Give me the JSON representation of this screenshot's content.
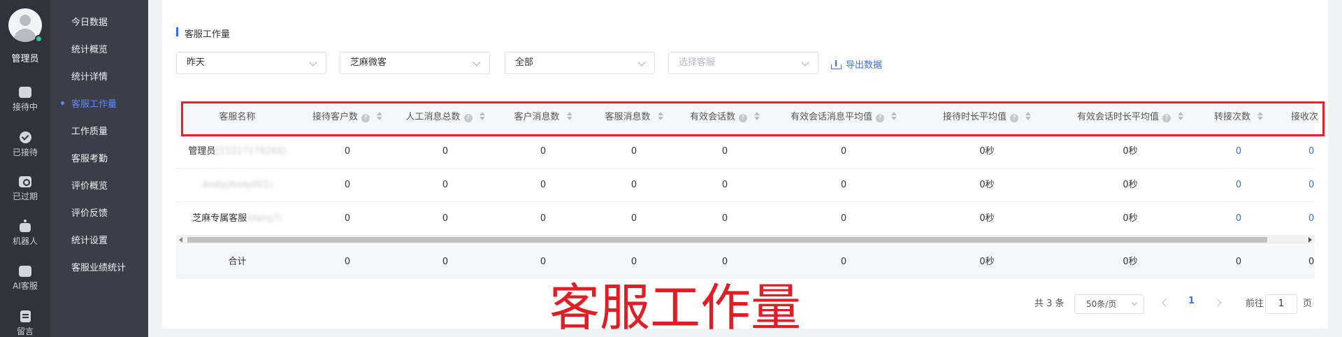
{
  "rail": {
    "admin_name": "管理员",
    "items": [
      {
        "label": "接待中",
        "icon": "chat-icon"
      },
      {
        "label": "已接待",
        "icon": "check-circle-icon"
      },
      {
        "label": "已过期",
        "icon": "expired-icon"
      },
      {
        "label": "机器人",
        "icon": "robot-icon"
      },
      {
        "label": "AI客服",
        "icon": "ai-chat-icon"
      },
      {
        "label": "留言",
        "icon": "message-note-icon"
      }
    ]
  },
  "menu": {
    "items": [
      "今日数据",
      "统计概览",
      "统计详情",
      "客服工作量",
      "工作质量",
      "客服考勤",
      "评价概览",
      "评价反馈",
      "统计设置",
      "客服业绩统计"
    ],
    "active_index": 3,
    "accent_color": "#5d8bff"
  },
  "section": {
    "title": "客服工作量"
  },
  "filters": {
    "date": "昨天",
    "scene": "芝麻微客",
    "scope": "全部",
    "agent_placeholder": "选择客服",
    "export_label": "导出数据"
  },
  "table": {
    "columns": [
      "客服名称",
      "接待客户数",
      "人工消息总数",
      "客户消息数",
      "客服消息数",
      "有效会话数",
      "有效会话消息平均值",
      "接待时长平均值",
      "有效会话时长平均值",
      "转接次数",
      "接收次"
    ],
    "rows": [
      {
        "name": "管理员",
        "name_suffix": "(15317178266)",
        "values": [
          "0",
          "0",
          "0",
          "0",
          "0",
          "0",
          "0秒",
          "0秒",
          "0",
          "0"
        ]
      },
      {
        "name": "",
        "name_suffix": "Andy(Andy001)",
        "values": [
          "0",
          "0",
          "0",
          "0",
          "0",
          "0",
          "0秒",
          "0秒",
          "0",
          "0"
        ]
      },
      {
        "name": "芝麻专属客服",
        "name_suffix": "(dany7)",
        "values": [
          "0",
          "0",
          "0",
          "0",
          "0",
          "0",
          "0秒",
          "0秒",
          "0",
          "0"
        ]
      }
    ],
    "total": {
      "label": "合计",
      "values": [
        "0",
        "0",
        "0",
        "0",
        "0",
        "0",
        "0秒",
        "0秒",
        "0",
        "0"
      ]
    }
  },
  "caption": "客服工作量",
  "pagination": {
    "total_text": "共 3 条",
    "page_size": "50条/页",
    "current_page": "1",
    "goto_label": "前往",
    "goto_value": "1",
    "page_unit": "页"
  },
  "colors": {
    "highlight": "#e8202a",
    "link": "#3d6fe8",
    "caption": "#e11d26"
  }
}
